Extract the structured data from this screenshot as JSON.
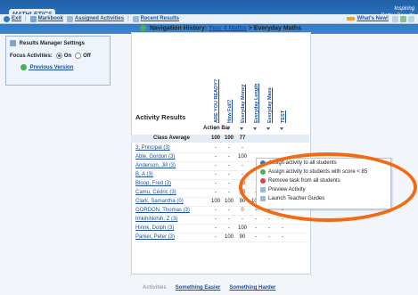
{
  "app": {
    "logo_text": "MATHLETICS",
    "tagline": "Inspiring Better Results"
  },
  "nav": {
    "exit": "Exit",
    "markbook": "Markbook",
    "assigned": "Assigned Activities",
    "recent": "Recent Results",
    "whats_new": "What's New!"
  },
  "settings_panel": {
    "title": "Results Manager Settings",
    "focus_label": "Focus Activities:",
    "on_label": "On",
    "off_label": "Off",
    "focus_value": "On",
    "previous_version": "Previous Version"
  },
  "history": {
    "label": "Navigation History:",
    "link": "Year 4 Maths",
    "sep": ">",
    "current": "Everyday Maths"
  },
  "results": {
    "title": "Activity Results",
    "action_bar": "Action Bar",
    "columns": [
      "ARE YOU READY?",
      "How Full?",
      "Everyday Money",
      "Everyday Length",
      "Everyday Mass",
      "TEST"
    ],
    "class_average_label": "Class Average",
    "class_average": [
      "100",
      "100",
      "77",
      "",
      "",
      ""
    ],
    "students": [
      {
        "name": "3, Principal (3)",
        "scores": [
          "-",
          "-",
          "-",
          "",
          "",
          ""
        ]
      },
      {
        "name": "Able, Gordon (3)",
        "scores": [
          "-",
          "-",
          "100",
          "",
          "",
          ""
        ]
      },
      {
        "name": "Anderson, Jill (3)",
        "scores": [
          "-",
          "-",
          "-",
          "",
          "",
          ""
        ]
      },
      {
        "name": "B, A (3)",
        "scores": [
          "-",
          "-",
          "-",
          "",
          "",
          ""
        ]
      },
      {
        "name": "Bloop, Fred (3)",
        "scores": [
          "-",
          "-",
          "70",
          "",
          "",
          ""
        ]
      },
      {
        "name": "Camu, Cédric (3)",
        "scores": [
          "-",
          "-",
          "90",
          "-",
          "-",
          "-"
        ]
      },
      {
        "name": "Clark, Samantha (0)",
        "scores": [
          "100",
          "100",
          "90",
          "100",
          "90",
          "100"
        ]
      },
      {
        "name": "GORDON, Thomas (3)",
        "scores": [
          "-",
          "-",
          "0",
          "-",
          "-",
          "-"
        ]
      },
      {
        "name": "hhkihihkihih, Z (3)",
        "scores": [
          "-",
          "-",
          "-",
          "-",
          "-",
          "-"
        ]
      },
      {
        "name": "Hinnk, Dolph (3)",
        "scores": [
          "-",
          "-",
          "100",
          "-",
          "-",
          "-"
        ]
      },
      {
        "name": "Parker, Peter (3)",
        "scores": [
          "-",
          "100",
          "90",
          "-",
          "-",
          "-"
        ]
      }
    ]
  },
  "context_menu": {
    "items": [
      {
        "label": "Assign activity to all students",
        "icon": "assign-icon"
      },
      {
        "label": "Assign activity to students with score < 85",
        "icon": "assign-score-icon"
      },
      {
        "label": "Remove task from all students",
        "icon": "remove-icon"
      },
      {
        "label": "Preview Activity",
        "icon": "preview-icon"
      },
      {
        "label": "Launch Teacher Guides",
        "icon": "guide-icon"
      }
    ]
  },
  "bottom": {
    "activities": "Activities",
    "easier": "Something Easier",
    "harder": "Something Harder"
  },
  "colors": {
    "brand": "#1f5fa8",
    "highlight": "#f26a12",
    "low_score": "#dd2222"
  }
}
